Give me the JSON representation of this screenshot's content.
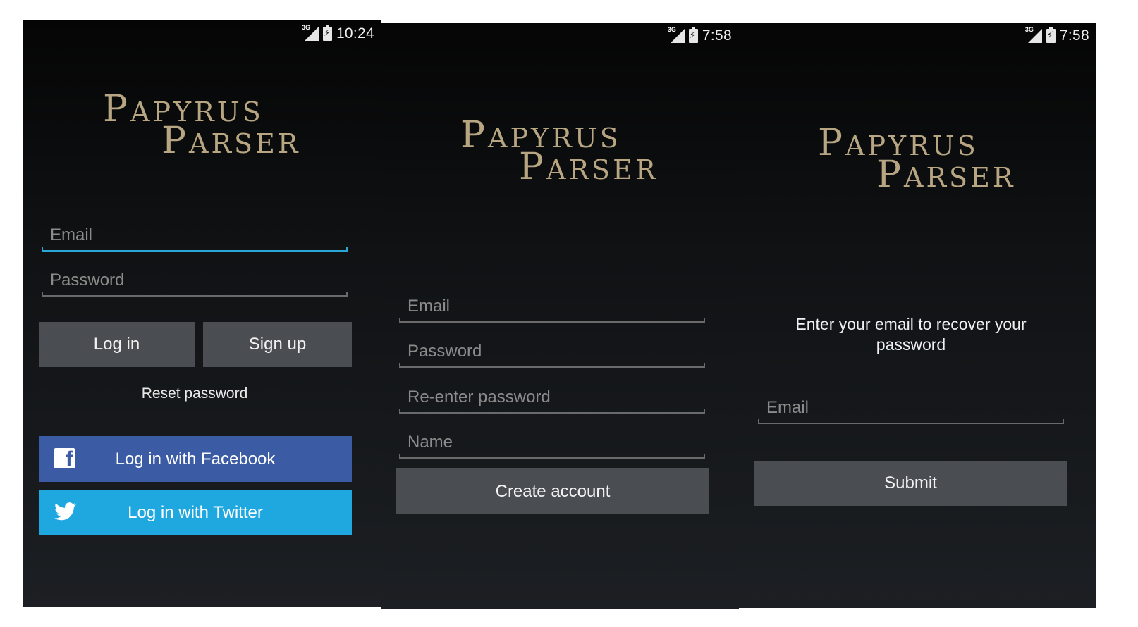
{
  "brand": {
    "line1": "Papyrus",
    "line2": "Parser",
    "color": "#b8a683"
  },
  "screens": {
    "login": {
      "status_time": "10:24",
      "network": "3G",
      "email_placeholder": "Email",
      "password_placeholder": "Password",
      "login_button": "Log in",
      "signup_button": "Sign up",
      "reset_link": "Reset password",
      "facebook_button": "Log in with Facebook",
      "twitter_button": "Log in with Twitter",
      "icons": {
        "facebook": "facebook-icon",
        "twitter": "twitter-icon"
      },
      "colors": {
        "facebook": "#3b5ba5",
        "twitter": "#1fa7e0",
        "focus": "#2aa6d7"
      }
    },
    "signup": {
      "status_time": "7:58",
      "network": "3G",
      "email_placeholder": "Email",
      "password_placeholder": "Password",
      "reenter_placeholder": "Re-enter password",
      "name_placeholder": "Name",
      "create_button": "Create account"
    },
    "reset": {
      "status_time": "7:58",
      "network": "3G",
      "message": "Enter your email to recover your password",
      "email_placeholder": "Email",
      "submit_button": "Submit"
    }
  }
}
